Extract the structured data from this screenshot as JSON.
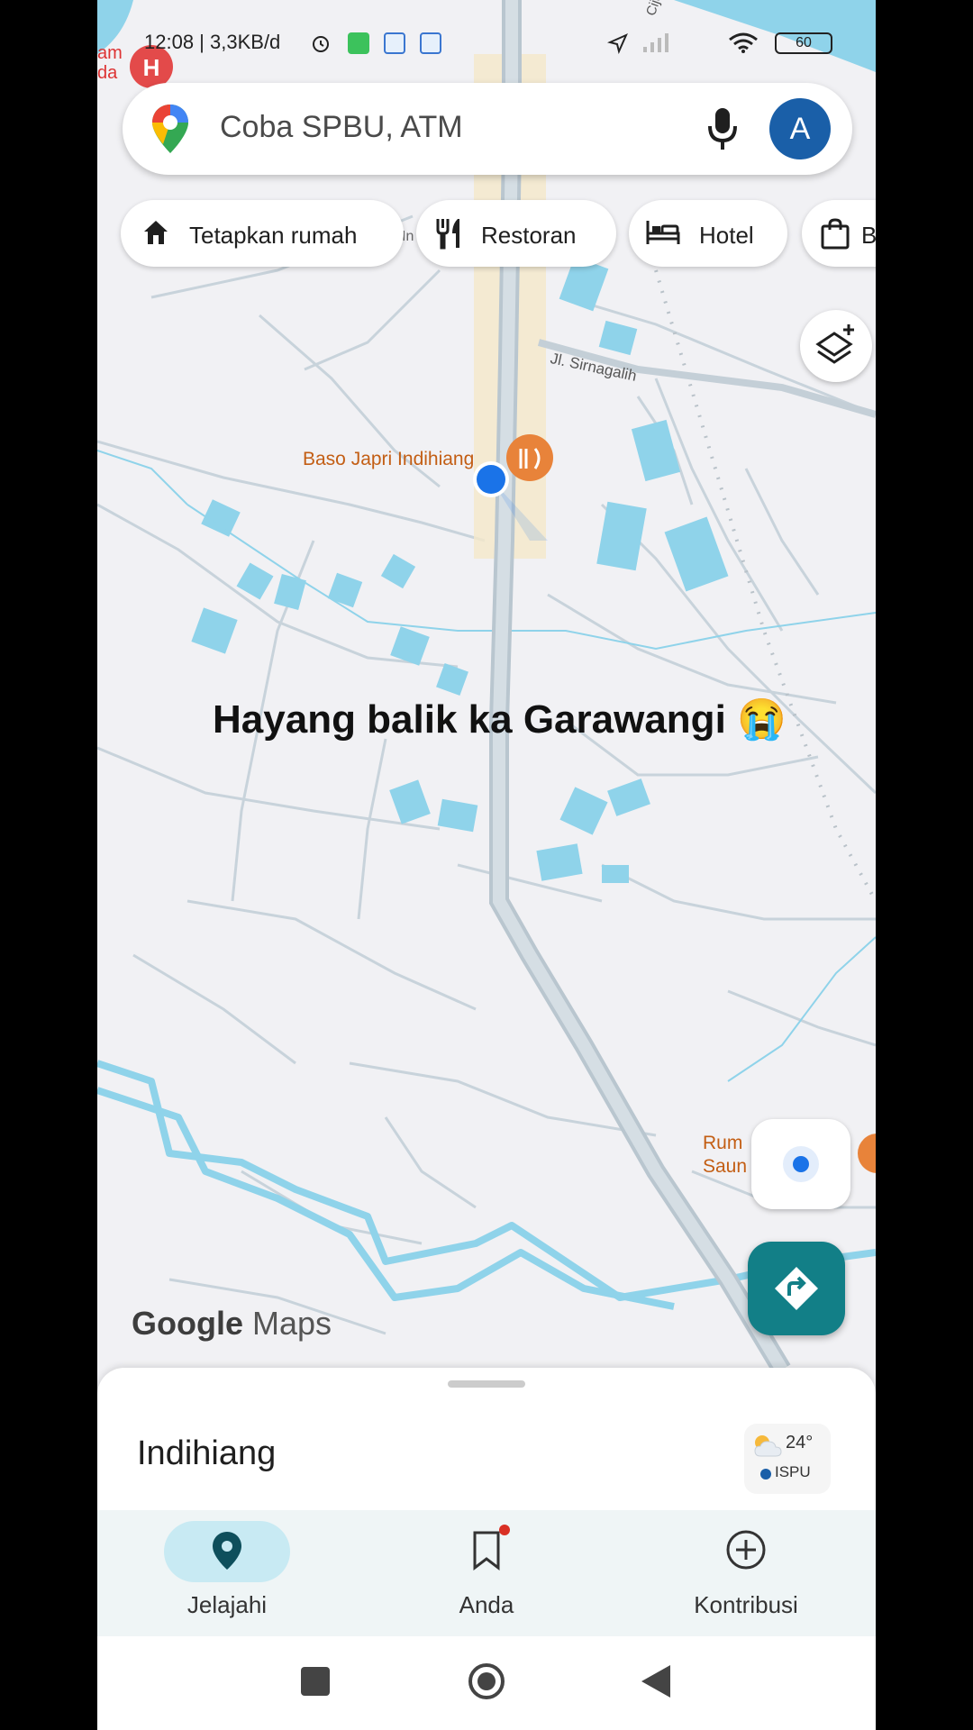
{
  "status_bar": {
    "time": "12:08",
    "network_speed": "3,3KB/d",
    "battery": "60",
    "icons": [
      "alarm-icon",
      "whatsapp-icon",
      "app-notification-icon",
      "app-notification-icon",
      "location-arrow-icon",
      "signal-icon",
      "wifi-icon",
      "battery-icon"
    ]
  },
  "search": {
    "placeholder": "Coba SPBU, ATM",
    "avatar_letter": "A"
  },
  "chips": [
    {
      "label": "Tetapkan rumah",
      "icon": "home-icon"
    },
    {
      "label": "Restoran",
      "icon": "restaurant-icon"
    },
    {
      "label": "Hotel",
      "icon": "hotel-icon"
    },
    {
      "label": "B",
      "icon": "shopping-bag-icon"
    }
  ],
  "map": {
    "labels": {
      "hospital_top_left_line1": "am",
      "hospital_top_left_line2": "da",
      "road_jl": "Jl. Sirnagalih",
      "road_top_right": "Cijojong Jeng",
      "road_small": "In",
      "poi_restaurant": "Baso Japri Indihiang",
      "poi_bottom_right_line1": "Rum",
      "poi_bottom_right_line2": "Saun",
      "poi_bottom_right_suffix1": "n",
      "poi_bottom_right_suffix2": "n"
    },
    "overlay_caption": "Hayang balik ka Garawangi 😭",
    "watermark_google": "Google",
    "watermark_maps": "Maps",
    "colors": {
      "water": "#8fd3ea",
      "road": "#c9d4dc",
      "user_dot": "#1a73e8",
      "restaurant_pin": "#e8833a",
      "hospital_pin": "#e34a4a"
    }
  },
  "sheet": {
    "place_name": "Indihiang",
    "weather_temp": "24°",
    "weather_aqi": "ISPU"
  },
  "bottom_nav": [
    {
      "label": "Jelajahi",
      "icon": "explore-pin-icon",
      "active": true
    },
    {
      "label": "Anda",
      "icon": "bookmark-icon",
      "active": false
    },
    {
      "label": "Kontribusi",
      "icon": "add-circle-icon",
      "active": false
    }
  ],
  "accent_color": "#127f87"
}
